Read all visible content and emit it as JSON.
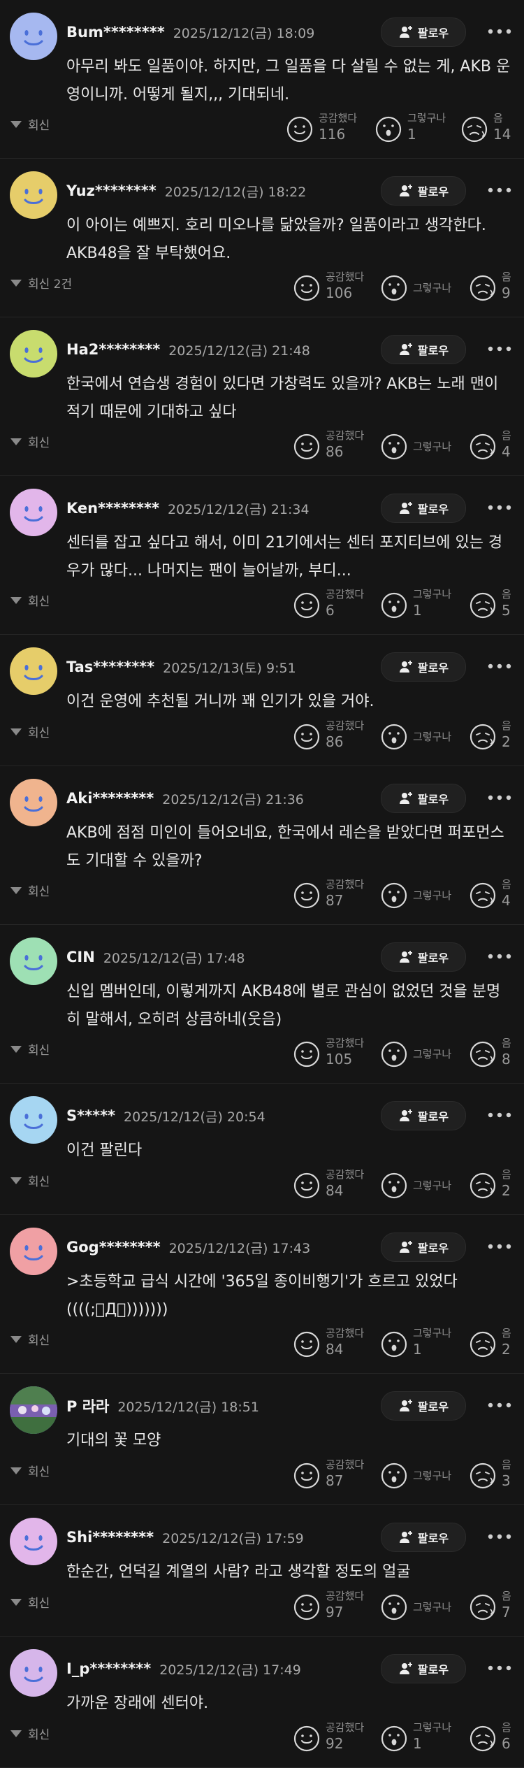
{
  "ui": {
    "follow_label": "팔로우",
    "reply_label": "회신",
    "reactions": [
      {
        "label": "공감했다",
        "icon": "smile-face-icon"
      },
      {
        "label": "그렇구나",
        "icon": "surprised-face-icon"
      },
      {
        "label": "음",
        "icon": "sad-face-icon"
      }
    ]
  },
  "comments": [
    {
      "user": "Bum********",
      "date": "2025/12/12(금) 18:09",
      "text": "아무리 봐도 일품이야. 하지만, 그 일품을 다 살릴 수 없는 게, AKB 운영이니까. 어떻게 될지,,, 기대되네.",
      "reply": "회신",
      "counts": [
        "116",
        "1",
        "14"
      ],
      "avatar_color": "#a6b8f0"
    },
    {
      "user": "Yuz********",
      "date": "2025/12/12(금) 18:22",
      "text": "이 아이는 예쁘지. 호리 미오나를 닮았을까? 일품이라고 생각한다. AKB48을 잘 부탁했어요.",
      "reply": "회신 2건",
      "counts": [
        "106",
        "",
        "9"
      ],
      "avatar_color": "#e6cd6a"
    },
    {
      "user": "Ha2********",
      "date": "2025/12/12(금) 21:48",
      "text": "한국에서 연습생 경험이 있다면 가창력도 있을까? AKB는 노래 맨이 적기 때문에 기대하고 싶다",
      "reply": "회신",
      "counts": [
        "86",
        "",
        "4"
      ],
      "avatar_color": "#c8dc6e"
    },
    {
      "user": "Ken********",
      "date": "2025/12/12(금) 21:34",
      "text": "센터를 잡고 싶다고 해서, 이미 21기에서는 센터 포지티브에 있는 경우가 많다... 나머지는 팬이 늘어날까, 부디...",
      "reply": "회신",
      "counts": [
        "6",
        "1",
        "5"
      ],
      "avatar_color": "#e2b6ea"
    },
    {
      "user": "Tas********",
      "date": "2025/12/13(토) 9:51",
      "text": "이건 운영에 추천될 거니까 꽤 인기가 있을 거야.",
      "reply": "회신",
      "counts": [
        "86",
        "",
        "2"
      ],
      "avatar_color": "#e6cd6a"
    },
    {
      "user": "Aki********",
      "date": "2025/12/12(금) 21:36",
      "text": "AKB에 점점 미인이 들어오네요, 한국에서 레슨을 받았다면 퍼포먼스도 기대할 수 있을까?",
      "reply": "회신",
      "counts": [
        "87",
        "",
        "4"
      ],
      "avatar_color": "#f0b48e"
    },
    {
      "user": "CIN",
      "date": "2025/12/12(금) 17:48",
      "text": "신입 멤버인데, 이렇게까지 AKB48에 별로 관심이 없었던 것을 분명히 말해서, 오히려 상큼하네(웃음)",
      "reply": "회신",
      "counts": [
        "105",
        "",
        "8"
      ],
      "avatar_color": "#9ee0b4"
    },
    {
      "user": "S*****",
      "date": "2025/12/12(금) 20:54",
      "text": "이건 팔린다",
      "reply": "회신",
      "counts": [
        "84",
        "",
        "2"
      ],
      "avatar_color": "#a6d6f2"
    },
    {
      "user": "Gog********",
      "date": "2025/12/12(금) 17:43",
      "text": ">초등학교 급식 시간에 '365일 종이비행기'가 흐르고 있었다 ((((;゚Д゚)))))))",
      "reply": "회신",
      "counts": [
        "84",
        "1",
        "2"
      ],
      "avatar_color": "#f0a0a4"
    },
    {
      "user": "P 라라",
      "date": "2025/12/12(금) 18:51",
      "text": "기대의 꽃 모양",
      "reply": "회신",
      "counts": [
        "87",
        "",
        "3"
      ],
      "avatar_color": "photo"
    },
    {
      "user": "Shi********",
      "date": "2025/12/12(금) 17:59",
      "text": "한순간, 언덕길 계열의 사람? 라고 생각할 정도의 얼굴",
      "reply": "회신",
      "counts": [
        "97",
        "",
        "7"
      ],
      "avatar_color": "#e2b6ea"
    },
    {
      "user": "I_p********",
      "date": "2025/12/12(금) 17:49",
      "text": "가까운 장래에 센터야.",
      "reply": "회신",
      "counts": [
        "92",
        "1",
        "6"
      ],
      "avatar_color": "#d6b6ea"
    }
  ]
}
